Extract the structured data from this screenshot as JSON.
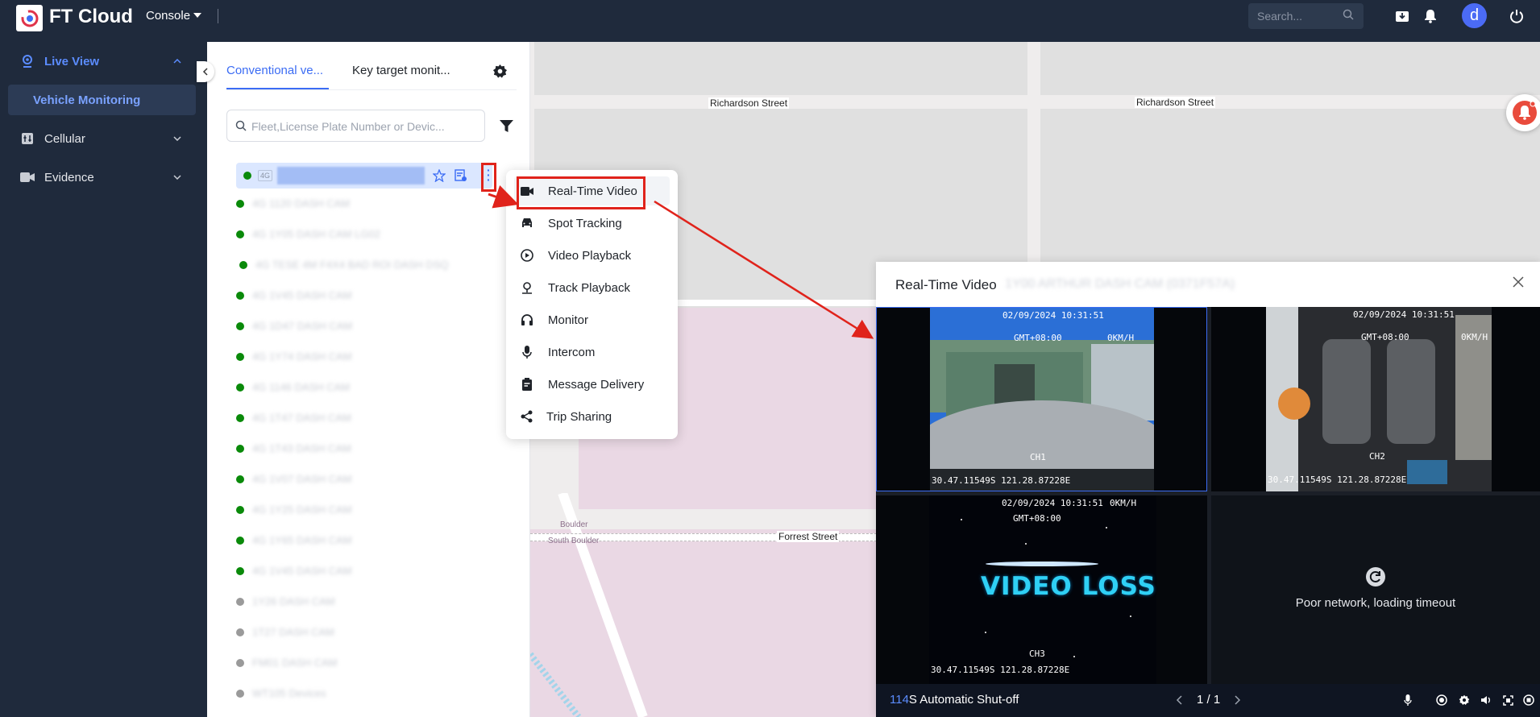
{
  "header": {
    "brand": "FT Cloud",
    "console_label": "Console",
    "search_placeholder": "Search...",
    "avatar_letter": "d"
  },
  "sidebar": {
    "items": [
      {
        "label": "Live View",
        "expanded": true
      },
      {
        "label": "Cellular",
        "expanded": false
      },
      {
        "label": "Evidence",
        "expanded": false
      }
    ],
    "sub_item": "Vehicle Monitoring"
  },
  "panel": {
    "tabs": [
      "Conventional ve...",
      "Key target monit..."
    ],
    "filter_placeholder": "Fleet,License Plate Number or Devic...",
    "selected_badge": "4G",
    "vehicles": [
      {
        "text": "4G 1120 DASH CAM",
        "status": "online"
      },
      {
        "text": "4G 1Y05 DASH CAM LG02",
        "status": "online"
      },
      {
        "text": "4G TESE 4M F4X4 BAD ROI DASH DSQ",
        "status": "online"
      },
      {
        "text": "4G 1V45 DASH CAM",
        "status": "online"
      },
      {
        "text": "4G 1D47 DASH CAM",
        "status": "online"
      },
      {
        "text": "4G 1Y74 DASH CAM",
        "status": "online"
      },
      {
        "text": "4G 1146 DASH CAM",
        "status": "online"
      },
      {
        "text": "4G 1T47 DASH CAM",
        "status": "online"
      },
      {
        "text": "4G 1T43 DASH CAM",
        "status": "online"
      },
      {
        "text": "4G 1V07 DASH CAM",
        "status": "online"
      },
      {
        "text": "4G 1Y25 DASH CAM",
        "status": "online"
      },
      {
        "text": "4G 1Y65 DASH CAM",
        "status": "online"
      },
      {
        "text": "4G 1V45 DASH CAM",
        "status": "online"
      },
      {
        "text": "1Y26 DASH CAM",
        "status": "offline"
      },
      {
        "text": "1T27 DASH CAM",
        "status": "offline"
      },
      {
        "text": "FM01 DASH CAM",
        "status": "offline"
      },
      {
        "text": "WT105 Devices",
        "status": "offline"
      }
    ]
  },
  "menu": {
    "items": [
      {
        "label": "Real-Time Video",
        "icon": "video-camera-icon"
      },
      {
        "label": "Spot Tracking",
        "icon": "car-icon"
      },
      {
        "label": "Video Playback",
        "icon": "playback-icon"
      },
      {
        "label": "Track Playback",
        "icon": "location-pin-icon"
      },
      {
        "label": "Monitor",
        "icon": "headphones-icon"
      },
      {
        "label": "Intercom",
        "icon": "microphone-icon"
      },
      {
        "label": "Message Delivery",
        "icon": "clipboard-icon"
      },
      {
        "label": "Trip Sharing",
        "icon": "share-icon"
      }
    ]
  },
  "map": {
    "streets": [
      "Richardson Street",
      "Richardson Street",
      "Forrest Street"
    ],
    "suburbs": [
      "Boulder",
      "South Boulder"
    ]
  },
  "video": {
    "title": "Real-Time Video",
    "subtitle": "1Y00 ARTHUR DASH CAM (0371F57A)",
    "channels": [
      {
        "date": "02/09/2024 10:31:51",
        "gmt": "GMT+08:00",
        "speed": "0KM/H",
        "ch": "CH1",
        "coords": "30.47.11549S 121.28.87228E"
      },
      {
        "date": "02/09/2024 10:31:51",
        "gmt": "GMT+08:00",
        "speed": "0KM/H",
        "ch": "CH2",
        "coords": "30.47.11549S 121.28.87228E"
      },
      {
        "date": "02/09/2024 10:31:51",
        "gmt": "GMT+08:00",
        "speed": "0KM/H",
        "ch": "CH3",
        "coords": "30.47.11549S 121.28.87228E",
        "banner": "VIDEO LOSS"
      }
    ],
    "timeout_text": "Poor network, loading timeout",
    "shutoff_num": "114",
    "shutoff_text": "S Automatic Shut-off",
    "page": "1 / 1"
  }
}
